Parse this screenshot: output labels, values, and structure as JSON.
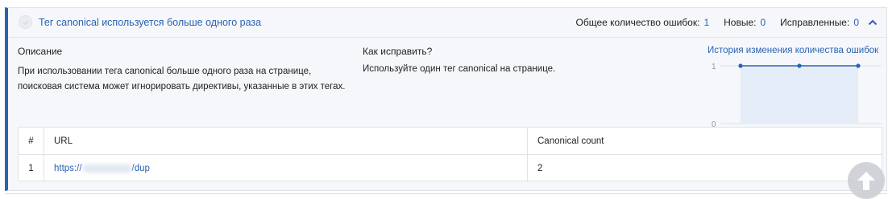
{
  "section": {
    "title": "Тег canonical используется больше одного раза",
    "stats": [
      {
        "label": "Общее количество ошибок:",
        "value": "1"
      },
      {
        "label": "Новые:",
        "value": "0"
      },
      {
        "label": "Исправленные:",
        "value": "0"
      }
    ]
  },
  "description": {
    "heading": "Описание",
    "text": "При использовании тега canonical больше одного раза на странице, поисковая система может игнорировать директивы, указанные в этих тегах."
  },
  "fix": {
    "heading": "Как исправить?",
    "text": "Используйте один тег canonical на странице."
  },
  "history": {
    "title": "История изменения количества ошибок"
  },
  "chart_data": {
    "type": "area",
    "x": [
      1,
      2,
      3
    ],
    "values": [
      1,
      1,
      1
    ],
    "ylim": [
      0,
      1
    ],
    "yticks": [
      "0",
      "1"
    ],
    "grid": true,
    "color": "#2a62b3",
    "fill": "#e3ecf7"
  },
  "table": {
    "columns": [
      "#",
      "URL",
      "Canonical count"
    ],
    "rows": [
      {
        "num": "1",
        "url_prefix": "https://",
        "url_suffix": "/dup",
        "count": "2"
      }
    ]
  },
  "colors": {
    "accent": "#2a62b3",
    "panel_bg": "#f5f7fa"
  }
}
